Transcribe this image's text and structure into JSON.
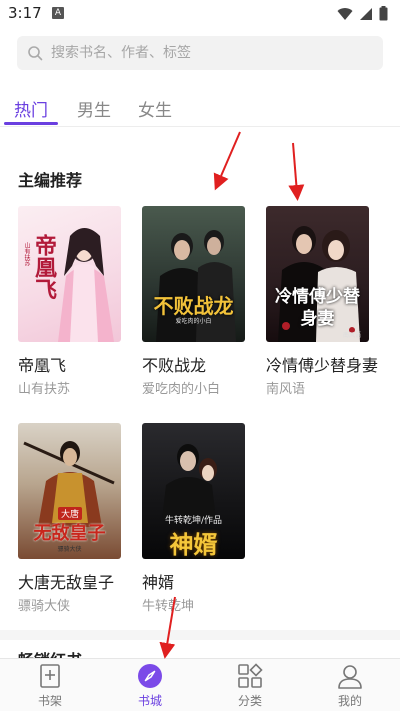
{
  "status_bar": {
    "time": "3:17",
    "notification_badge": "A",
    "icons": [
      "wifi-icon",
      "signal-icon",
      "battery-icon"
    ]
  },
  "search": {
    "placeholder": "搜索书名、作者、标签"
  },
  "tabs": [
    {
      "label": "热门",
      "active": true
    },
    {
      "label": "男生",
      "active": false
    },
    {
      "label": "女生",
      "active": false
    }
  ],
  "section": {
    "title": "主编推荐",
    "books": [
      {
        "title": "帝凰飞",
        "author": "山有扶苏",
        "cover_text": "帝凰飞",
        "cover_byline": "山有扶苏"
      },
      {
        "title": "不败战龙",
        "author": "爱吃肉的小白",
        "cover_text": "不败战龙",
        "cover_byline": "爱吃肉的小白"
      },
      {
        "title": "冷情傅少替身妻",
        "author": "南风语",
        "cover_text": "冷情傅少替身妻",
        "cover_byline": "南风语"
      },
      {
        "title": "大唐无敌皇子",
        "author": "骠骑大侠",
        "cover_text": "无敌皇子",
        "cover_badge": "大唐",
        "cover_byline": "骠骑大侠"
      },
      {
        "title": "神婿",
        "author": "牛转乾坤",
        "cover_text": "神婿",
        "cover_byline": "牛转乾坤/作品"
      }
    ]
  },
  "next_section": {
    "title": "畅销红书"
  },
  "bottom_nav": [
    {
      "label": "书架",
      "icon": "bookshelf-icon",
      "active": false
    },
    {
      "label": "书城",
      "icon": "compass-icon",
      "active": true
    },
    {
      "label": "分类",
      "icon": "category-icon",
      "active": false
    },
    {
      "label": "我的",
      "icon": "profile-icon",
      "active": false
    }
  ],
  "colors": {
    "accent": "#6a3fe0",
    "annotation_arrow": "#e02020"
  }
}
